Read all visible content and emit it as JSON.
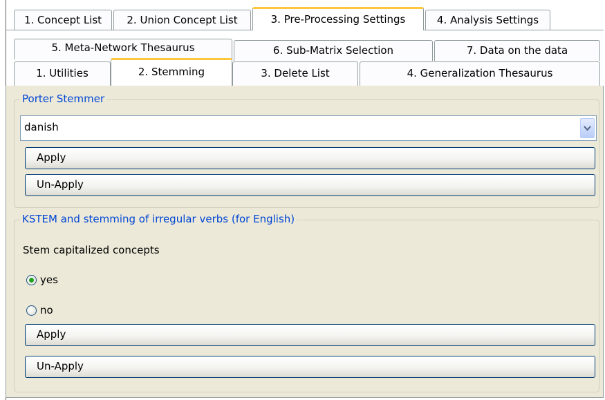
{
  "main_tabs": [
    {
      "label": "1. Concept List",
      "selected": false
    },
    {
      "label": "2. Union Concept List",
      "selected": false
    },
    {
      "label": "3. Pre-Processing Settings",
      "selected": true
    },
    {
      "label": "4. Analysis Settings",
      "selected": false
    }
  ],
  "sub_tabs_row1": [
    {
      "label": "5. Meta-Network Thesaurus"
    },
    {
      "label": "6. Sub-Matrix Selection"
    },
    {
      "label": "7. Data on the data"
    }
  ],
  "sub_tabs_row2": [
    {
      "label": "1. Utilities",
      "selected": false
    },
    {
      "label": "2. Stemming",
      "selected": true
    },
    {
      "label": "3. Delete List",
      "selected": false
    },
    {
      "label": "4. Generalization Thesaurus",
      "selected": false
    }
  ],
  "porter": {
    "title": "Porter Stemmer",
    "selected_language": "danish",
    "apply_label": "Apply",
    "unapply_label": "Un-Apply"
  },
  "kstem": {
    "title": "KSTEM and stemming of irregular verbs (for English)",
    "question": "Stem capitalized concepts",
    "options": [
      {
        "label": "yes",
        "checked": true
      },
      {
        "label": "no",
        "checked": false
      }
    ],
    "apply_label": "Apply",
    "unapply_label": "Un-Apply"
  },
  "colors": {
    "panel_bg": "#ece9d8",
    "selected_tab_accent": "#ffc83c",
    "group_title": "#0046d5",
    "button_border": "#003c74",
    "radio_dot": "#21a121"
  }
}
